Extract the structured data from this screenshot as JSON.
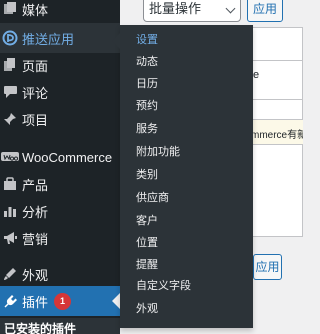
{
  "sidebar": {
    "items": [
      {
        "key": "media",
        "label": "媒体",
        "icon": "media-icon"
      },
      {
        "key": "push",
        "label": "推送应用",
        "icon": "push-app-icon"
      },
      {
        "key": "pages",
        "label": "页面",
        "icon": "pages-icon"
      },
      {
        "key": "comments",
        "label": "评论",
        "icon": "comments-icon"
      },
      {
        "key": "projects",
        "label": "项目",
        "icon": "pin-icon"
      },
      {
        "key": "woocommerce",
        "label": "WooCommerce",
        "icon": "woocommerce-icon"
      },
      {
        "key": "products",
        "label": "产品",
        "icon": "products-icon"
      },
      {
        "key": "analytics",
        "label": "分析",
        "icon": "analytics-icon"
      },
      {
        "key": "marketing",
        "label": "营销",
        "icon": "megaphone-icon"
      },
      {
        "key": "appearance",
        "label": "外观",
        "icon": "appearance-icon"
      },
      {
        "key": "plugins",
        "label": "插件",
        "icon": "plugin-icon",
        "badge": "1"
      }
    ],
    "footer_header": "已安装的插件"
  },
  "flyout": {
    "items": [
      "设置",
      "动态",
      "日历",
      "预约",
      "服务",
      "附加功能",
      "类别",
      "供应商",
      "客户",
      "位置",
      "提醒",
      "自定义字段",
      "外观"
    ],
    "active_index": 0
  },
  "content": {
    "bulk_action_label": "批量操作",
    "apply_label": "应用",
    "apply_label_2": "应用",
    "notice_text": "mmerce有新版",
    "peek_char": "e"
  },
  "colors": {
    "sidebar_bg": "#1d2327",
    "flyout_bg": "#2c3338",
    "accent_blue": "#2271b1",
    "hover_text": "#72aee6",
    "badge_red": "#d63638"
  }
}
